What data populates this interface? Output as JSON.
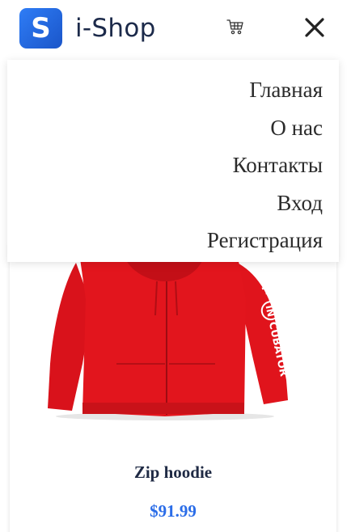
{
  "header": {
    "logo_letter": "S",
    "brand": "i-Shop"
  },
  "icons": {
    "cart": "cart-icon",
    "close": "close-icon"
  },
  "menu": {
    "items": [
      {
        "label": "Главная"
      },
      {
        "label": "О нас"
      },
      {
        "label": "Контакты"
      },
      {
        "label": "Вход"
      },
      {
        "label": "Регистрация"
      }
    ]
  },
  "product": {
    "name": "Zip hoodie",
    "price": "$91.99",
    "sleeve_print": "IT·IN CUBATOR",
    "image_desc_color": "#e0141c"
  },
  "colors": {
    "brand_blue": "#2a6ee8",
    "price_blue": "#2b6de8",
    "hoodie_red": "#e0141c"
  }
}
